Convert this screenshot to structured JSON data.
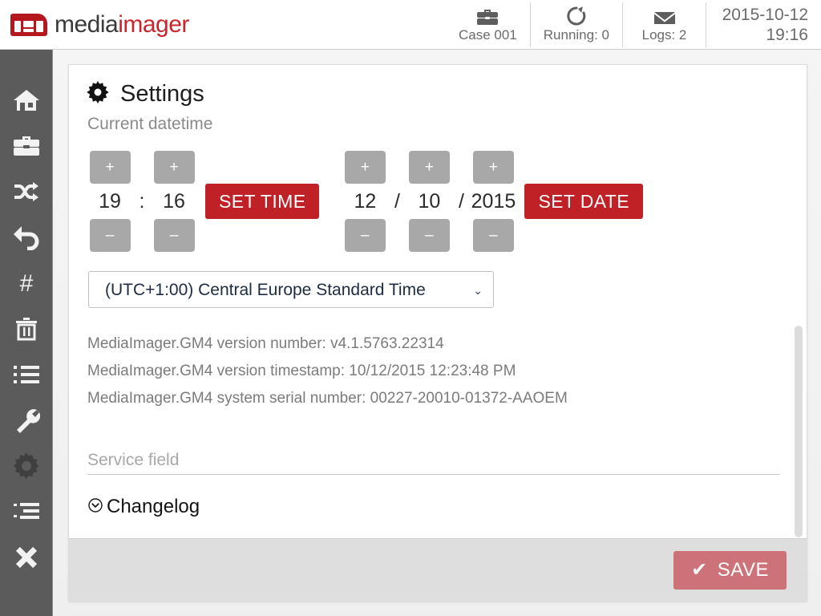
{
  "app": {
    "logo_text_primary": "media",
    "logo_text_accent": "imager",
    "accent_red": "#bf2127",
    "logo_red": "#c8262d",
    "sidebar_bg": "#5b5b5b"
  },
  "header": {
    "status": [
      {
        "icon": "briefcase-icon",
        "label": "Case 001"
      },
      {
        "icon": "rotate-icon",
        "label": "Running: 0"
      },
      {
        "icon": "envelope-icon",
        "label": "Logs: 2"
      }
    ],
    "clock": {
      "date": "2015-10-12",
      "time": "19:16"
    }
  },
  "sidebar": {
    "items": [
      {
        "icon": "home-icon",
        "name": "home",
        "active": false
      },
      {
        "icon": "briefcase-icon",
        "name": "cases",
        "active": false
      },
      {
        "icon": "shuffle-icon",
        "name": "shuffle",
        "active": false
      },
      {
        "icon": "undo-icon",
        "name": "undo",
        "active": false
      },
      {
        "icon": "hash-icon",
        "name": "hash",
        "active": false
      },
      {
        "icon": "trash-icon",
        "name": "trash",
        "active": false
      },
      {
        "icon": "list-icon",
        "name": "list",
        "active": false
      },
      {
        "icon": "wrench-icon",
        "name": "tools",
        "active": false
      },
      {
        "icon": "gear-icon",
        "name": "settings",
        "active": true
      },
      {
        "icon": "list-indent-icon",
        "name": "log-list",
        "active": false
      },
      {
        "icon": "close-icon",
        "name": "exit",
        "active": false
      }
    ]
  },
  "settings": {
    "title": "Settings",
    "subtitle": "Current datetime",
    "time": {
      "hour": "19",
      "separator": ":",
      "minute": "16",
      "increment_label": "+",
      "decrement_label": "–",
      "set_button": "SET TIME"
    },
    "date": {
      "day": "12",
      "separator1": "/",
      "month": "10",
      "separator2": "/",
      "year": "2015",
      "increment_label": "+",
      "decrement_label": "–",
      "set_button": "SET DATE"
    },
    "timezone": {
      "selected": "(UTC+1:00) Central Europe Standard Time",
      "options": [
        "(UTC+1:00) Central Europe Standard Time"
      ]
    },
    "info_lines": [
      "MediaImager.GM4 version number: v4.1.5763.22314",
      "MediaImager.GM4 version timestamp: 10/12/2015 12:23:48 PM",
      "MediaImager.GM4 system serial number: 00227-20010-01372-AAOEM"
    ],
    "service_field": {
      "placeholder": "Service field",
      "value": ""
    },
    "changelog": {
      "label": "Changelog",
      "icon": "chevron-down-circle-icon"
    },
    "footer": {
      "save_label": "SAVE",
      "save_check": "✔"
    }
  }
}
